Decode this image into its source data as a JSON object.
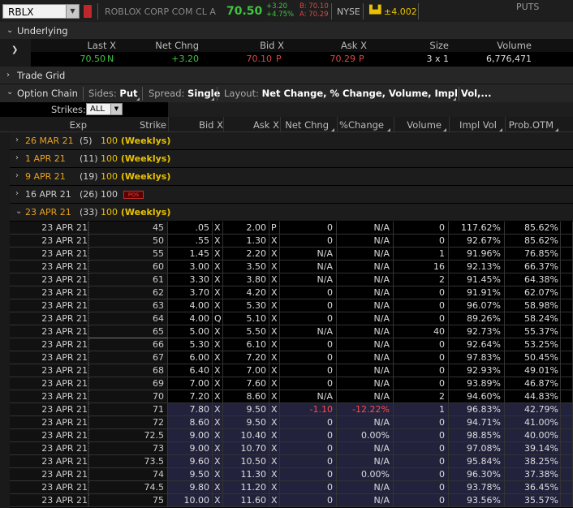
{
  "toolbar": {
    "symbol": "RBLX",
    "description": "ROBLOX CORP COM CL A",
    "last_price": "70.50",
    "change_abs": "+3.20",
    "change_pct": "+4.75%",
    "bid_line": "B: 70.10",
    "ask_line": "A: 70.29",
    "exchange": "NYSE",
    "expected_move": "±4.002",
    "colors": {
      "up": "#3ec43e",
      "down": "#e04545",
      "accent": "#e8c200"
    }
  },
  "underlying": {
    "section_label": "Underlying",
    "headers": {
      "last": "Last X",
      "net_change": "Net Chng",
      "bid": "Bid X",
      "ask": "Ask X",
      "size": "Size",
      "volume": "Volume"
    },
    "values": {
      "last": "70.50",
      "last_exch": "N",
      "net_change": "+3.20",
      "bid": "70.10",
      "bid_exch": "P",
      "ask": "70.29",
      "ask_exch": "P",
      "size": "3 x 1",
      "volume": "6,776,471"
    }
  },
  "trade_grid": {
    "label": "Trade Grid"
  },
  "option_chain": {
    "label": "Option Chain",
    "sides_label": "Sides:",
    "sides_value": "Put",
    "spread_label": "Spread:",
    "spread_value": "Single",
    "layout_label": "Layout:",
    "layout_value": "Net Change, % Change, Volume, Impl Vol,...",
    "strikes_label": "Strikes:",
    "strikes_value": "ALL",
    "side_header": "PUTS",
    "columns": {
      "exp": "Exp",
      "strike": "Strike",
      "bid": "Bid X",
      "ask": "Ask X",
      "net_change": "Net Chng",
      "pct_change": "%Change",
      "volume": "Volume",
      "impl_vol": "Impl Vol",
      "prob_otm": "Prob.OTM"
    }
  },
  "expirations": [
    {
      "date": "26 MAR 21",
      "days": "(5)",
      "mult": "100",
      "tag": "(Weeklys)",
      "expanded": false,
      "pos_badge": ""
    },
    {
      "date": "1 APR 21",
      "days": "(11)",
      "mult": "100",
      "tag": "(Weeklys)",
      "expanded": false,
      "pos_badge": ""
    },
    {
      "date": "9 APR 21",
      "days": "(19)",
      "mult": "100",
      "tag": "(Weeklys)",
      "expanded": false,
      "pos_badge": ""
    },
    {
      "date": "16 APR 21",
      "days": "(26)",
      "mult": "100",
      "tag": "",
      "expanded": false,
      "pos_badge": "POS"
    },
    {
      "date": "23 APR 21",
      "days": "(33)",
      "mult": "100",
      "tag": "(Weeklys)",
      "expanded": true,
      "pos_badge": ""
    }
  ],
  "rows": [
    {
      "exp": "23 APR 21",
      "strike": "45",
      "bid": ".05",
      "bx": "X",
      "ask": "2.00",
      "ax": "P",
      "nchg": "0",
      "pchg": "N/A",
      "vol": "0",
      "iv": "117.62%",
      "potm": "85.62%",
      "itm": false
    },
    {
      "exp": "23 APR 21",
      "strike": "50",
      "bid": ".55",
      "bx": "X",
      "ask": "1.30",
      "ax": "X",
      "nchg": "0",
      "pchg": "N/A",
      "vol": "0",
      "iv": "92.67%",
      "potm": "85.62%",
      "itm": false
    },
    {
      "exp": "23 APR 21",
      "strike": "55",
      "bid": "1.45",
      "bx": "X",
      "ask": "2.20",
      "ax": "X",
      "nchg": "N/A",
      "pchg": "N/A",
      "vol": "1",
      "iv": "91.96%",
      "potm": "76.85%",
      "itm": false
    },
    {
      "exp": "23 APR 21",
      "strike": "60",
      "bid": "3.00",
      "bx": "X",
      "ask": "3.50",
      "ax": "X",
      "nchg": "N/A",
      "pchg": "N/A",
      "vol": "16",
      "iv": "92.13%",
      "potm": "66.37%",
      "itm": false
    },
    {
      "exp": "23 APR 21",
      "strike": "61",
      "bid": "3.30",
      "bx": "X",
      "ask": "3.80",
      "ax": "X",
      "nchg": "N/A",
      "pchg": "N/A",
      "vol": "2",
      "iv": "91.45%",
      "potm": "64.38%",
      "itm": false
    },
    {
      "exp": "23 APR 21",
      "strike": "62",
      "bid": "3.70",
      "bx": "X",
      "ask": "4.20",
      "ax": "X",
      "nchg": "0",
      "pchg": "N/A",
      "vol": "0",
      "iv": "91.91%",
      "potm": "62.07%",
      "itm": false
    },
    {
      "exp": "23 APR 21",
      "strike": "63",
      "bid": "4.00",
      "bx": "X",
      "ask": "5.30",
      "ax": "X",
      "nchg": "0",
      "pchg": "N/A",
      "vol": "0",
      "iv": "96.07%",
      "potm": "58.98%",
      "itm": false
    },
    {
      "exp": "23 APR 21",
      "strike": "64",
      "bid": "4.00",
      "bx": "Q",
      "ask": "5.10",
      "ax": "X",
      "nchg": "0",
      "pchg": "N/A",
      "vol": "0",
      "iv": "89.26%",
      "potm": "58.24%",
      "itm": false
    },
    {
      "exp": "23 APR 21",
      "strike": "65",
      "bid": "5.00",
      "bx": "X",
      "ask": "5.50",
      "ax": "X",
      "nchg": "N/A",
      "pchg": "N/A",
      "vol": "40",
      "iv": "92.73%",
      "potm": "55.37%",
      "itm": false
    },
    {
      "exp": "23 APR 21",
      "strike": "66",
      "bid": "5.30",
      "bx": "X",
      "ask": "6.10",
      "ax": "X",
      "nchg": "0",
      "pchg": "N/A",
      "vol": "0",
      "iv": "92.64%",
      "potm": "53.25%",
      "itm": false
    },
    {
      "exp": "23 APR 21",
      "strike": "67",
      "bid": "6.00",
      "bx": "X",
      "ask": "7.20",
      "ax": "X",
      "nchg": "0",
      "pchg": "N/A",
      "vol": "0",
      "iv": "97.83%",
      "potm": "50.45%",
      "itm": false
    },
    {
      "exp": "23 APR 21",
      "strike": "68",
      "bid": "6.40",
      "bx": "X",
      "ask": "7.00",
      "ax": "X",
      "nchg": "0",
      "pchg": "N/A",
      "vol": "0",
      "iv": "92.93%",
      "potm": "49.01%",
      "itm": false
    },
    {
      "exp": "23 APR 21",
      "strike": "69",
      "bid": "7.00",
      "bx": "X",
      "ask": "7.60",
      "ax": "X",
      "nchg": "0",
      "pchg": "N/A",
      "vol": "0",
      "iv": "93.89%",
      "potm": "46.87%",
      "itm": false
    },
    {
      "exp": "23 APR 21",
      "strike": "70",
      "bid": "7.20",
      "bx": "X",
      "ask": "8.60",
      "ax": "X",
      "nchg": "N/A",
      "pchg": "N/A",
      "vol": "2",
      "iv": "94.60%",
      "potm": "44.83%",
      "itm": false
    },
    {
      "exp": "23 APR 21",
      "strike": "71",
      "bid": "7.80",
      "bx": "X",
      "ask": "9.50",
      "ax": "X",
      "nchg": "-1.10",
      "pchg": "-12.22%",
      "vol": "1",
      "iv": "96.83%",
      "potm": "42.79%",
      "itm": true
    },
    {
      "exp": "23 APR 21",
      "strike": "72",
      "bid": "8.60",
      "bx": "X",
      "ask": "9.50",
      "ax": "X",
      "nchg": "0",
      "pchg": "N/A",
      "vol": "0",
      "iv": "94.71%",
      "potm": "41.00%",
      "itm": true
    },
    {
      "exp": "23 APR 21",
      "strike": "72.5",
      "bid": "9.00",
      "bx": "X",
      "ask": "10.40",
      "ax": "X",
      "nchg": "0",
      "pchg": "0.00%",
      "vol": "0",
      "iv": "98.85%",
      "potm": "40.00%",
      "itm": true
    },
    {
      "exp": "23 APR 21",
      "strike": "73",
      "bid": "9.00",
      "bx": "X",
      "ask": "10.70",
      "ax": "X",
      "nchg": "0",
      "pchg": "N/A",
      "vol": "0",
      "iv": "97.08%",
      "potm": "39.14%",
      "itm": true
    },
    {
      "exp": "23 APR 21",
      "strike": "73.5",
      "bid": "9.60",
      "bx": "X",
      "ask": "10.50",
      "ax": "X",
      "nchg": "0",
      "pchg": "N/A",
      "vol": "0",
      "iv": "95.84%",
      "potm": "38.25%",
      "itm": true
    },
    {
      "exp": "23 APR 21",
      "strike": "74",
      "bid": "9.50",
      "bx": "X",
      "ask": "11.30",
      "ax": "X",
      "nchg": "0",
      "pchg": "0.00%",
      "vol": "0",
      "iv": "96.30%",
      "potm": "37.38%",
      "itm": true
    },
    {
      "exp": "23 APR 21",
      "strike": "74.5",
      "bid": "9.80",
      "bx": "X",
      "ask": "11.20",
      "ax": "X",
      "nchg": "0",
      "pchg": "N/A",
      "vol": "0",
      "iv": "93.78%",
      "potm": "36.45%",
      "itm": true
    },
    {
      "exp": "23 APR 21",
      "strike": "75",
      "bid": "10.00",
      "bx": "X",
      "ask": "11.60",
      "ax": "X",
      "nchg": "0",
      "pchg": "N/A",
      "vol": "0",
      "iv": "93.56%",
      "potm": "35.57%",
      "itm": true
    }
  ]
}
